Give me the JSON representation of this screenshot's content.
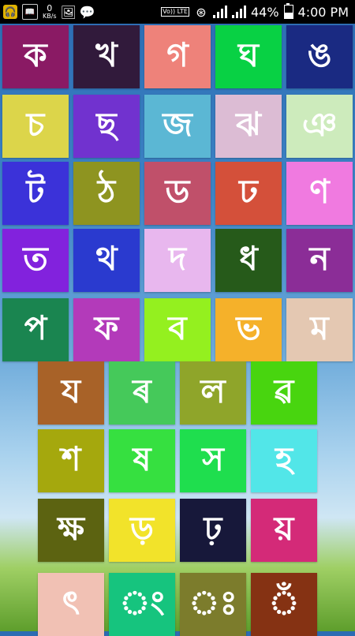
{
  "status_bar": {
    "net_speed_value": "0",
    "net_speed_unit": "KB/s",
    "volte_label": "Vo)) LTE",
    "battery_percent": "44%",
    "time": "4:00 PM",
    "icons": [
      "headset-icon",
      "book-icon",
      "photo-icon",
      "messenger-icon",
      "volte-icon",
      "nfc-icon",
      "signal-icon",
      "signal-icon",
      "battery-icon"
    ]
  },
  "letters": [
    {
      "text": "ক",
      "color": "#8a1a64"
    },
    {
      "text": "খ",
      "color": "#311a3b"
    },
    {
      "text": "গ",
      "color": "#ee827a"
    },
    {
      "text": "ঘ",
      "color": "#08d144"
    },
    {
      "text": "ঙ",
      "color": "#1a2a82"
    },
    {
      "text": "চ",
      "color": "#dcd54a"
    },
    {
      "text": "ছ",
      "color": "#7132cf"
    },
    {
      "text": "জ",
      "color": "#5bb7d4"
    },
    {
      "text": "ঝ",
      "color": "#dcbcd4"
    },
    {
      "text": "ঞ",
      "color": "#cdebbc"
    },
    {
      "text": "ট",
      "color": "#3b32d9"
    },
    {
      "text": "ঠ",
      "color": "#8e9420"
    },
    {
      "text": "ড",
      "color": "#c0506a"
    },
    {
      "text": "ঢ",
      "color": "#d4503a"
    },
    {
      "text": "ণ",
      "color": "#f07ae0"
    },
    {
      "text": "ত",
      "color": "#8222dd"
    },
    {
      "text": "থ",
      "color": "#2a3acf"
    },
    {
      "text": "দ",
      "color": "#e8b7ee"
    },
    {
      "text": "ধ",
      "color": "#265a1a"
    },
    {
      "text": "ন",
      "color": "#8b2d97"
    },
    {
      "text": "প",
      "color": "#1a8550"
    },
    {
      "text": "ফ",
      "color": "#b33aba"
    },
    {
      "text": "ব",
      "color": "#94f01f"
    },
    {
      "text": "ভ",
      "color": "#f5b12a"
    },
    {
      "text": "ম",
      "color": "#e4c8b2"
    },
    {
      "text": "য",
      "color": "#a86228"
    },
    {
      "text": "ৰ",
      "color": "#45c95a"
    },
    {
      "text": "ল",
      "color": "#8fa52a"
    },
    {
      "text": "ৱ",
      "color": "#48d50f"
    },
    {
      "text": "শ",
      "color": "#a5a80d"
    },
    {
      "text": "ষ",
      "color": "#36e040"
    },
    {
      "text": "স",
      "color": "#1fde4e"
    },
    {
      "text": "হ",
      "color": "#52e6e8"
    },
    {
      "text": "ক্ষ",
      "color": "#5c6311"
    },
    {
      "text": "ড়",
      "color": "#f2e32a"
    },
    {
      "text": "ঢ়",
      "color": "#17183a"
    },
    {
      "text": "য়",
      "color": "#d42a78"
    },
    {
      "text": "ৎ",
      "color": "#f1c1b4"
    },
    {
      "text": "ং",
      "color": "#16c47e"
    },
    {
      "text": "ঃ",
      "color": "#7c7c2c"
    },
    {
      "text": "ঁ",
      "color": "#853213"
    }
  ]
}
